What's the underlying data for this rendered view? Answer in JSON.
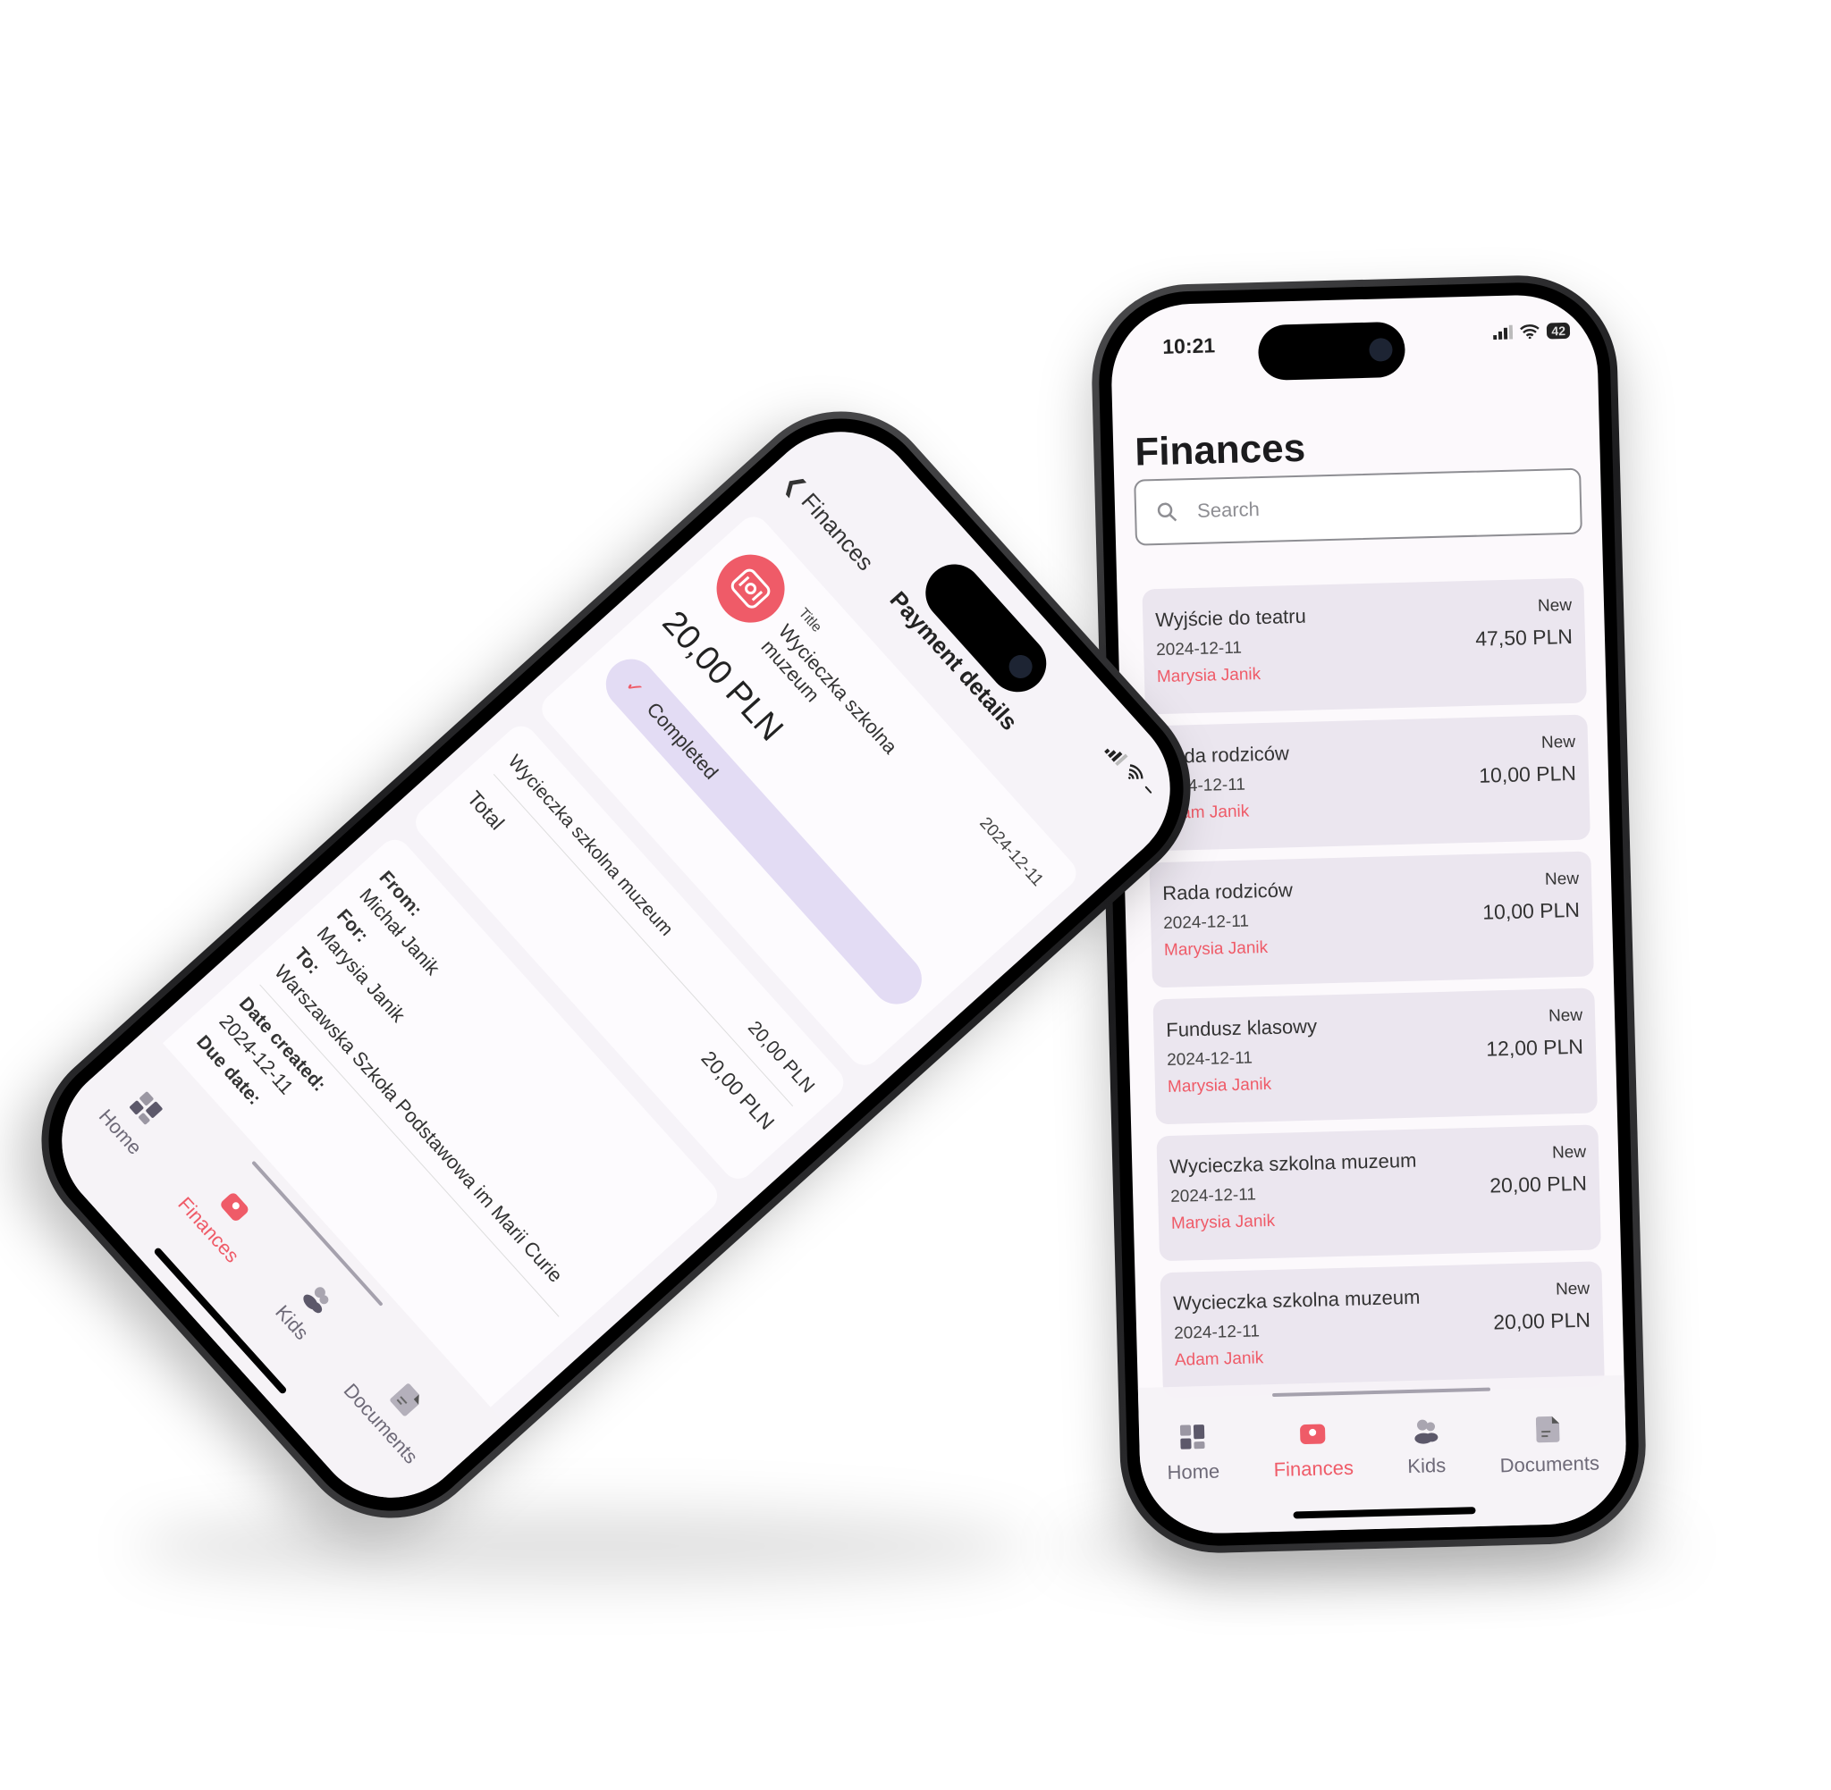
{
  "colors": {
    "accent": "#ef5b68",
    "card": "#ebe6ef",
    "pill": "#e3dcf4"
  },
  "list_screen": {
    "status": {
      "time": "10:21",
      "battery": "42"
    },
    "title": "Finances",
    "search": {
      "placeholder": "Search",
      "icon": "search-icon"
    },
    "items": [
      {
        "title": "Wyjście do teatru",
        "date": "2024-12-11",
        "kid": "Marysia Janik",
        "status": "New",
        "amount": "47,50 PLN"
      },
      {
        "title": "Rada rodziców",
        "date": "2024-12-11",
        "kid": "Adam Janik",
        "status": "New",
        "amount": "10,00 PLN"
      },
      {
        "title": "Rada rodziców",
        "date": "2024-12-11",
        "kid": "Marysia Janik",
        "status": "New",
        "amount": "10,00 PLN"
      },
      {
        "title": "Fundusz klasowy",
        "date": "2024-12-11",
        "kid": "Marysia Janik",
        "status": "New",
        "amount": "12,00 PLN"
      },
      {
        "title": "Wycieczka szkolna muzeum",
        "date": "2024-12-11",
        "kid": "Marysia Janik",
        "status": "New",
        "amount": "20,00 PLN"
      },
      {
        "title": "Wycieczka szkolna muzeum",
        "date": "2024-12-11",
        "kid": "Adam Janik",
        "status": "New",
        "amount": "20,00 PLN"
      }
    ]
  },
  "tabs": [
    {
      "label": "Home",
      "icon": "home-grid-icon"
    },
    {
      "label": "Finances",
      "icon": "wallet-icon",
      "active": true
    },
    {
      "label": "Kids",
      "icon": "kids-icon"
    },
    {
      "label": "Documents",
      "icon": "document-icon"
    }
  ],
  "detail_screen": {
    "status": "Completed",
    "back_label": "Finances",
    "title": "Payment details",
    "title_label": "Title",
    "payment_title": "Wycieczka szkolna muzeum",
    "date": "2024-12-11",
    "amount": "20,00 PLN",
    "line_item": {
      "name": "Wycieczka szkolna muzeum",
      "amount": "20,00 PLN"
    },
    "total": {
      "label": "Total",
      "amount": "20,00 PLN"
    },
    "from_label": "From:",
    "from": "Michał Janik",
    "for_label": "For:",
    "for": "Marysia Janik",
    "to_label": "To:",
    "to": "Warszawska Szkoła Podstawowa im Marii Curie",
    "date_created_label": "Date created:",
    "date_created": "2024-12-11",
    "due_date_label": "Due date:"
  }
}
